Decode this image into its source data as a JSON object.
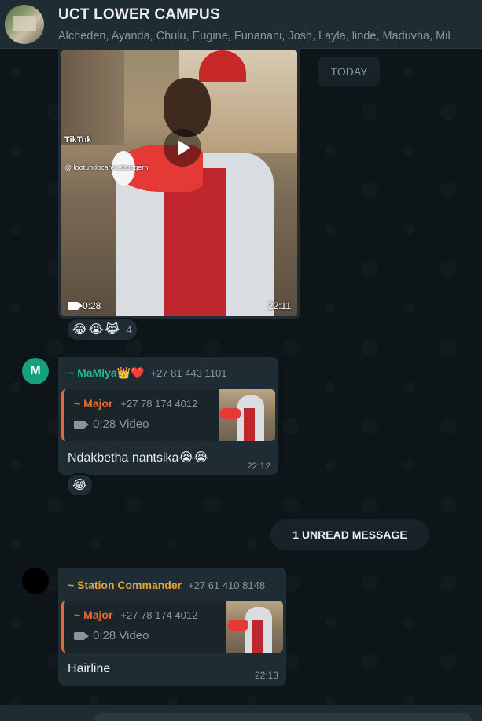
{
  "header": {
    "group_name": "UCT LOWER CAMPUS",
    "members": "Alcheden, Ayanda, Chulu, Eugine, Funanani, Josh, Layla, linde, Maduvha, Mil"
  },
  "date_chip": "TODAY",
  "video_message": {
    "tiktok_label": "TikTok",
    "tiktok_handle": "@ lootundocarecabongerh",
    "duration": "0:28",
    "time": "22:11",
    "reactions": [
      "😂",
      "😭",
      "😹"
    ],
    "reaction_count": "4"
  },
  "msg1": {
    "avatar_letter": "M",
    "sender": "~ MaMiya👑❤️",
    "phone": "+27 81 443 1101",
    "quote": {
      "name": "~ Major",
      "phone": "+27 78 174 4012",
      "media": "0:28 Video"
    },
    "text": "Ndakbetha nantsika😭😭",
    "time": "22:12",
    "reaction": "😂"
  },
  "unread_label": "1 UNREAD MESSAGE",
  "msg2": {
    "sender": "~ Station Commander",
    "phone": "+27 61 410 8148",
    "quote": {
      "name": "~ Major",
      "phone": "+27 78 174 4012",
      "media": "0:28 Video"
    },
    "text": "Hairline",
    "time": "22:13"
  },
  "colors": {
    "accent_green": "#25d366",
    "mamiya_name": "#25b88f",
    "commander_name": "#e5a13b",
    "quote_bar": "#e26a35",
    "avatar_m_bg": "#14a07c"
  }
}
